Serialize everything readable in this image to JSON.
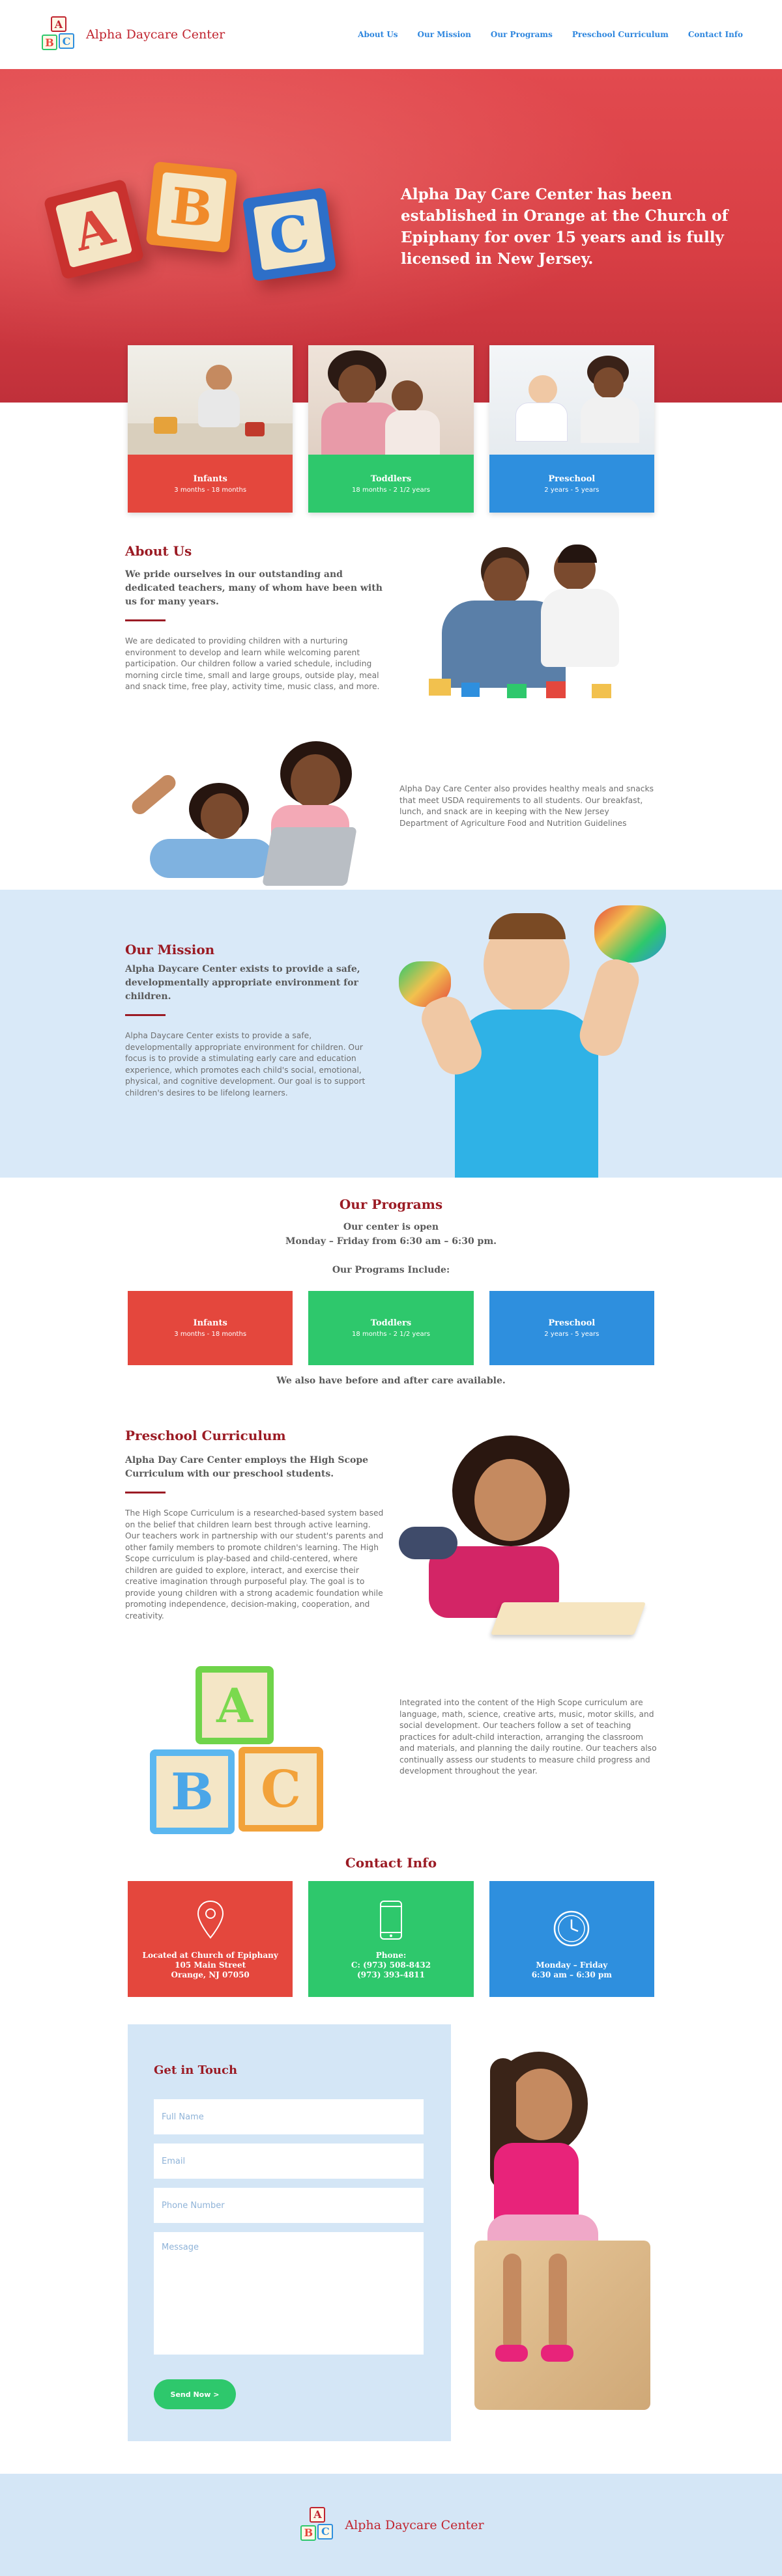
{
  "brand": {
    "name": "Alpha Daycare Center",
    "colors": {
      "red": "#e4473d",
      "green": "#2ec86c",
      "blue": "#2e8fde",
      "maroon": "#9b1b24",
      "light_blue": "#d9e9f8"
    }
  },
  "nav": [
    "About Us",
    "Our Mission",
    "Our Programs",
    "Preschool Curriculum",
    "Contact Info"
  ],
  "hero": {
    "title": "Alpha Day Care Center has been established in Orange at the Church of Epiphany for over 15 years and is fully licensed in New Jersey.",
    "blocks": [
      "A",
      "B",
      "C"
    ]
  },
  "cards": [
    {
      "title": "Infants",
      "sub": "3 months - 18 months"
    },
    {
      "title": "Toddlers",
      "sub": "18 months - 2 1/2 years"
    },
    {
      "title": "Preschool",
      "sub": "2 years - 5 years"
    }
  ],
  "about": {
    "heading": "About Us",
    "lead": "We pride ourselves in our outstanding and dedicated teachers, many of whom have been with us for many years.",
    "body": "We are dedicated to providing children with a nurturing environment to develop and learn while welcoming parent participation. Our children follow a varied schedule, including morning circle time, small and large groups, outside play, meal and snack time, free play, activity time, music class, and more.",
    "body2": "Alpha Day Care Center also provides healthy meals and snacks that meet USDA requirements to all students. Our breakfast, lunch, and snack are in keeping with the New Jersey Department of Agriculture Food and Nutrition Guidelines"
  },
  "mission": {
    "heading": "Our Mission",
    "lead": "Alpha Daycare Center exists to provide a safe, developmentally appropriate environment for children.",
    "body": "Alpha Daycare Center exists to provide a safe, developmentally appropriate environment for children. Our focus is to provide a stimulating early care and education experience, which promotes each child's social, emotional, physical, and cognitive development. Our goal is to support children's desires to be lifelong learners."
  },
  "programs": {
    "heading": "Our Programs",
    "hours_line1": "Our center is open",
    "hours_line2": "Monday – Friday from 6:30 am – 6:30 pm.",
    "include": "Our Programs Include:",
    "note": "We also have before and after care available."
  },
  "curriculum": {
    "heading": "Preschool Curriculum",
    "lead": "Alpha Day Care Center employs the High Scope Curriculum with our preschool students.",
    "body": "The High Scope Curriculum is a researched-based system based on the belief that children learn best through active learning. Our teachers work in partnership with our student's parents and other family members to promote children's learning. The High Scope curriculum is play-based and child-centered, where children are guided to explore, interact, and exercise their creative imagination through purposeful play. The goal is to provide young children with a strong academic foundation while promoting independence, decision-making, cooperation, and creativity.",
    "body2": "Integrated into the content of the High Scope curriculum are language, math, science, creative arts, music, motor skills, and social development. Our teachers follow a set of teaching practices for adult-child interaction, arranging the classroom and materials, and planning the daily routine. Our teachers also continually assess our students to measure child progress and development throughout the year.",
    "blocks": [
      "A",
      "B",
      "C"
    ]
  },
  "contact": {
    "heading": "Contact Info",
    "location": [
      "Located at Church of Epiphany",
      "105 Main Street",
      "Orange, NJ 07050"
    ],
    "phone": [
      "Phone:",
      "C: (973) 508-8432",
      "(973) 393-4811"
    ],
    "hours": [
      "Monday – Friday",
      "6:30 am – 6:30 pm"
    ],
    "icons": [
      "map-pin-icon",
      "phone-icon",
      "clock-icon"
    ]
  },
  "form": {
    "heading": "Get in Touch",
    "full_name": "Full Name",
    "email": "Email",
    "phone": "Phone Number",
    "message": "Message",
    "submit": "Send Now >"
  }
}
